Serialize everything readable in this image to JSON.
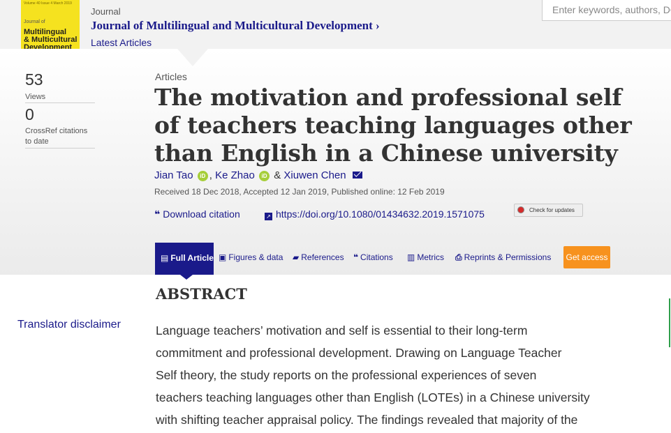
{
  "journal": {
    "cover": {
      "small_text": "Volume 40 Issue 4 March 2019",
      "journal_of": "Journal of",
      "line1": "Multilingual",
      "line2": "& Multicultural",
      "line3": "Development",
      "bg_color": "#f5e21f"
    },
    "label": "Journal",
    "title": "Journal of Multilingual and Multicultural Development",
    "title_chevron": "›",
    "latest": "Latest Articles"
  },
  "search": {
    "placeholder": "Enter keywords, authors, DOI"
  },
  "metrics": [
    {
      "value": "53",
      "label": "Views"
    },
    {
      "value": "0",
      "label": "CrossRef citations to date"
    }
  ],
  "article": {
    "type": "Articles",
    "title": "The motivation and professional self of teachers teaching languages other than English in a Chinese university",
    "authors": [
      {
        "name": "Jian Tao",
        "orcid": true
      },
      {
        "name": "Ke Zhao",
        "orcid": true
      },
      {
        "name": "Xiuwen Chen",
        "email": true
      }
    ],
    "author_sep_comma": ",",
    "author_sep_amp": "&",
    "orcid_text": "iD",
    "dates": "Received 18 Dec 2018, Accepted 12 Jan 2019, Published online: 12 Feb 2019",
    "download_citation": "Download citation",
    "doi": "https://doi.org/10.1080/01434632.2019.1571075",
    "check_updates": "Check for updates"
  },
  "tabs": [
    {
      "label": "Full Article",
      "icon": "document-icon",
      "glyph": "▤"
    },
    {
      "label": "Figures & data",
      "icon": "image-icon",
      "glyph": "▣"
    },
    {
      "label": "References",
      "icon": "book-icon",
      "glyph": "▰"
    },
    {
      "label": "Citations",
      "icon": "quote-icon",
      "glyph": "❝"
    },
    {
      "label": "Metrics",
      "icon": "bar-chart-icon",
      "glyph": "▥"
    },
    {
      "label": "Reprints & Permissions",
      "icon": "print-icon",
      "glyph": "⎙"
    }
  ],
  "get_access": "Get access",
  "abstract": {
    "heading": "ABSTRACT",
    "lines": [
      "Language teachers’ motivation and self is essential to their long-term",
      "commitment and professional development. Drawing on Language Teacher",
      "Self theory, the study reports on the professional experiences of seven",
      "teachers teaching languages other than English (LOTEs) in a Chinese university",
      "with shifting teacher appraisal policy. The findings revealed that majority of the"
    ]
  },
  "translator_disclaimer": "Translator disclaimer",
  "colors": {
    "link": "#1a1a8a",
    "accent_orange": "#f7921e",
    "orcid_green": "#a6ce39"
  }
}
